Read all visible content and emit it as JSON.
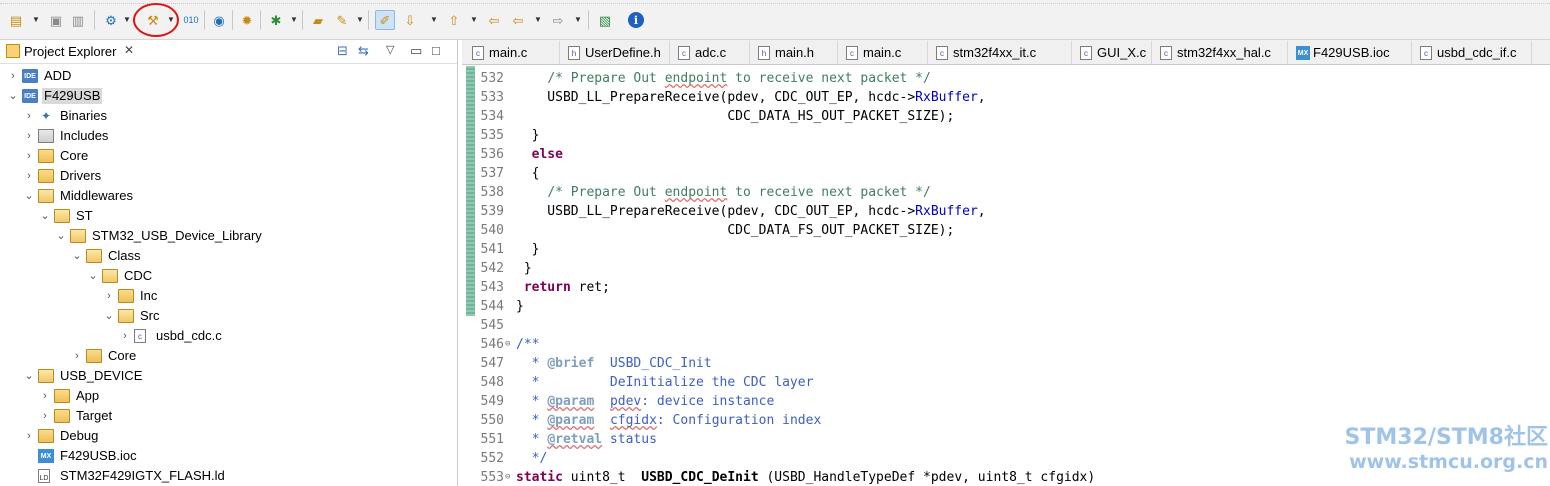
{
  "explorer": {
    "title": "Project Explorer",
    "close_glyph": "✕",
    "tree": [
      {
        "label": "ADD",
        "icon": "ide-project-icon",
        "arrow": "›",
        "depth": 0
      },
      {
        "label": "F429USB",
        "icon": "ide-project-icon",
        "arrow": "⌄",
        "depth": 0,
        "selected": true
      },
      {
        "label": "Binaries",
        "icon": "binaries-icon",
        "arrow": "›",
        "depth": 1
      },
      {
        "label": "Includes",
        "icon": "includes-icon",
        "arrow": "›",
        "depth": 1
      },
      {
        "label": "Core",
        "icon": "folder-icon",
        "arrow": "›",
        "depth": 1
      },
      {
        "label": "Drivers",
        "icon": "folder-icon",
        "arrow": "›",
        "depth": 1
      },
      {
        "label": "Middlewares",
        "icon": "folder-open-icon",
        "arrow": "⌄",
        "depth": 1
      },
      {
        "label": "ST",
        "icon": "folder-open-icon",
        "arrow": "⌄",
        "depth": 2
      },
      {
        "label": "STM32_USB_Device_Library",
        "icon": "folder-open-icon",
        "arrow": "⌄",
        "depth": 3
      },
      {
        "label": "Class",
        "icon": "folder-open-icon",
        "arrow": "⌄",
        "depth": 4
      },
      {
        "label": "CDC",
        "icon": "folder-open-icon",
        "arrow": "⌄",
        "depth": 5
      },
      {
        "label": "Inc",
        "icon": "folder-icon",
        "arrow": "›",
        "depth": 6
      },
      {
        "label": "Src",
        "icon": "folder-open-icon",
        "arrow": "⌄",
        "depth": 6
      },
      {
        "label": "usbd_cdc.c",
        "icon": "c-file-icon",
        "arrow": "›",
        "depth": 7
      },
      {
        "label": "Core",
        "icon": "folder-icon",
        "arrow": "›",
        "depth": 4
      },
      {
        "label": "USB_DEVICE",
        "icon": "folder-open-icon",
        "arrow": "⌄",
        "depth": 1
      },
      {
        "label": "App",
        "icon": "folder-icon",
        "arrow": "›",
        "depth": 2
      },
      {
        "label": "Target",
        "icon": "folder-icon",
        "arrow": "›",
        "depth": 2
      },
      {
        "label": "Debug",
        "icon": "folder-icon",
        "arrow": "›",
        "depth": 1
      },
      {
        "label": "F429USB.ioc",
        "icon": "mx-file-icon",
        "arrow": "",
        "depth": 1
      },
      {
        "label": "STM32F429IGTX_FLASH.ld",
        "icon": "ld-file-icon",
        "arrow": "",
        "depth": 1
      }
    ]
  },
  "tabs": [
    {
      "label": "main.c",
      "icon": "c"
    },
    {
      "label": "UserDefine.h",
      "icon": "h"
    },
    {
      "label": "adc.c",
      "icon": "c"
    },
    {
      "label": "main.h",
      "icon": "h"
    },
    {
      "label": "main.c",
      "icon": "c"
    },
    {
      "label": "stm32f4xx_it.c",
      "icon": "c"
    },
    {
      "label": "GUI_X.c",
      "icon": "c"
    },
    {
      "label": "stm32f4xx_hal.c",
      "icon": "c"
    },
    {
      "label": "F429USB.ioc",
      "icon": "mx"
    },
    {
      "label": "usbd_cdc_if.c",
      "icon": "c"
    }
  ],
  "code": [
    {
      "n": "532",
      "fold": "",
      "segs": [
        [
          "",
          "    "
        ],
        [
          "com",
          "/* Prepare Out "
        ],
        [
          "com-sq",
          "endpoint"
        ],
        [
          "com",
          " to receive next packet */"
        ]
      ]
    },
    {
      "n": "533",
      "fold": "",
      "segs": [
        [
          "",
          "    USBD_LL_PrepareReceive(pdev, CDC_OUT_EP, hcdc->"
        ],
        [
          "field",
          "RxBuffer"
        ],
        [
          "",
          ","
        ]
      ]
    },
    {
      "n": "534",
      "fold": "",
      "segs": [
        [
          "",
          "                           CDC_DATA_HS_OUT_PACKET_SIZE);"
        ]
      ]
    },
    {
      "n": "535",
      "fold": "",
      "segs": [
        [
          "",
          "  }"
        ]
      ]
    },
    {
      "n": "536",
      "fold": "",
      "segs": [
        [
          "",
          "  "
        ],
        [
          "kw",
          "else"
        ]
      ]
    },
    {
      "n": "537",
      "fold": "",
      "segs": [
        [
          "",
          "  {"
        ]
      ]
    },
    {
      "n": "538",
      "fold": "",
      "segs": [
        [
          "",
          "    "
        ],
        [
          "com",
          "/* Prepare Out "
        ],
        [
          "com-sq",
          "endpoint"
        ],
        [
          "com",
          " to receive next packet */"
        ]
      ]
    },
    {
      "n": "539",
      "fold": "",
      "segs": [
        [
          "",
          "    USBD_LL_PrepareReceive(pdev, CDC_OUT_EP, hcdc->"
        ],
        [
          "field",
          "RxBuffer"
        ],
        [
          "",
          ","
        ]
      ]
    },
    {
      "n": "540",
      "fold": "",
      "segs": [
        [
          "",
          "                           CDC_DATA_FS_OUT_PACKET_SIZE);"
        ]
      ]
    },
    {
      "n": "541",
      "fold": "",
      "segs": [
        [
          "",
          "  }"
        ]
      ]
    },
    {
      "n": "542",
      "fold": "",
      "segs": [
        [
          "",
          " }"
        ]
      ]
    },
    {
      "n": "543",
      "fold": "",
      "segs": [
        [
          "",
          " "
        ],
        [
          "kw",
          "return"
        ],
        [
          "",
          " ret;"
        ]
      ]
    },
    {
      "n": "544",
      "fold": "",
      "segs": [
        [
          "",
          "}"
        ]
      ]
    },
    {
      "n": "545",
      "fold": "",
      "segs": [
        [
          "",
          ""
        ]
      ]
    },
    {
      "n": "546",
      "fold": "⊖",
      "segs": [
        [
          "doc",
          "/**"
        ]
      ]
    },
    {
      "n": "547",
      "fold": "",
      "segs": [
        [
          "doc",
          "  * "
        ],
        [
          "tag",
          "@brief"
        ],
        [
          "doc",
          "  USBD_CDC_Init"
        ]
      ]
    },
    {
      "n": "548",
      "fold": "",
      "segs": [
        [
          "doc",
          "  *         DeInitialize the CDC layer"
        ]
      ]
    },
    {
      "n": "549",
      "fold": "",
      "segs": [
        [
          "doc",
          "  * "
        ],
        [
          "tag-sq",
          "@param"
        ],
        [
          "doc",
          "  "
        ],
        [
          "doc-sq",
          "pdev"
        ],
        [
          "doc",
          ": device instance"
        ]
      ]
    },
    {
      "n": "550",
      "fold": "",
      "segs": [
        [
          "doc",
          "  * "
        ],
        [
          "tag-sq",
          "@param"
        ],
        [
          "doc",
          "  "
        ],
        [
          "doc-sq",
          "cfgidx"
        ],
        [
          "doc",
          ": Configuration index"
        ]
      ]
    },
    {
      "n": "551",
      "fold": "",
      "segs": [
        [
          "doc",
          "  * "
        ],
        [
          "tag-sq",
          "@retval"
        ],
        [
          "doc",
          " status"
        ]
      ]
    },
    {
      "n": "552",
      "fold": "",
      "segs": [
        [
          "doc",
          "  */"
        ]
      ]
    },
    {
      "n": "553",
      "fold": "⊖",
      "segs": [
        [
          "kw",
          "static"
        ],
        [
          "",
          " uint8_t  "
        ],
        [
          "fn",
          "USBD_CDC_DeInit"
        ],
        [
          "",
          " (USBD_HandleTypeDef *pdev, uint8_t cfgidx)"
        ]
      ]
    }
  ],
  "watermark": {
    "line1": "STM32/STM8社区",
    "line2": "www.stmcu.org.cn"
  },
  "colors": {
    "accent": "#1f6fbf",
    "highlight_circle": "#e01414",
    "comment": "#3f7f5f",
    "doc_comment": "#3f5fbf",
    "keyword": "#7f0055",
    "field": "#0000c0"
  }
}
